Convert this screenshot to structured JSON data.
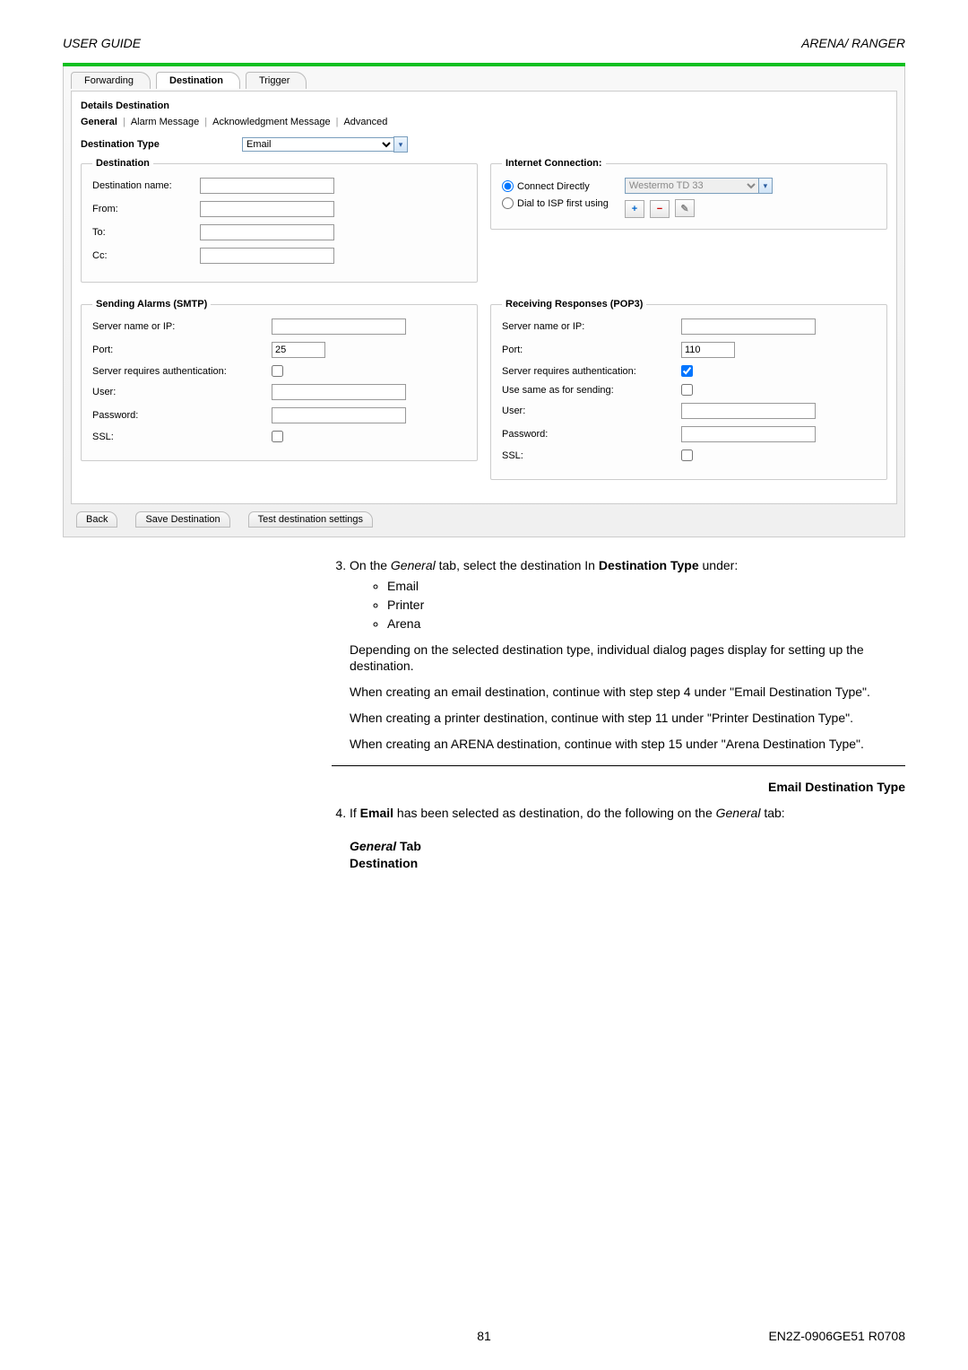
{
  "header": {
    "left": "USER GUIDE",
    "right": "ARENA/ RANGER"
  },
  "shot": {
    "top_tabs": {
      "forwarding": "Forwarding",
      "destination": "Destination",
      "trigger": "Trigger"
    },
    "section_title": "Details Destination",
    "sub_tabs": {
      "general": "General",
      "alarm": "Alarm Message",
      "ack": "Acknowledgment Message",
      "advanced": "Advanced"
    },
    "dest_type_label": "Destination Type",
    "dest_type_value": "Email",
    "destination_box": {
      "legend": "Destination",
      "fields": {
        "name_label": "Destination name:",
        "name_value": "",
        "from_label": "From:",
        "from_value": "",
        "to_label": "To:",
        "to_value": "",
        "cc_label": "Cc:",
        "cc_value": ""
      }
    },
    "internet_box": {
      "legend": "Internet Connection:",
      "connect_directly": "Connect Directly",
      "dial_isp": "Dial to ISP first using",
      "isp_value": "Westermo TD 33"
    },
    "smtp_box": {
      "legend": "Sending Alarms (SMTP)",
      "server_label": "Server name or IP:",
      "server_value": "",
      "port_label": "Port:",
      "port_value": "25",
      "auth_label": "Server requires authentication:",
      "user_label": "User:",
      "user_value": "",
      "pass_label": "Password:",
      "pass_value": "",
      "ssl_label": "SSL:"
    },
    "pop3_box": {
      "legend": "Receiving Responses (POP3)",
      "server_label": "Server name or IP:",
      "server_value": "",
      "port_label": "Port:",
      "port_value": "110",
      "auth_label": "Server requires authentication:",
      "same_label": "Use same as for sending:",
      "user_label": "User:",
      "user_value": "",
      "pass_label": "Password:",
      "pass_value": "",
      "ssl_label": "SSL:"
    },
    "bottom_buttons": {
      "back": "Back",
      "save": "Save Destination",
      "test": "Test destination settings"
    }
  },
  "doc": {
    "step3_intro_a": "On the ",
    "step3_intro_b": "General",
    "step3_intro_c": "  tab, select the destination In ",
    "step3_intro_d": "Destination Type",
    "step3_intro_e": " under:",
    "bullets": [
      "Email",
      "Printer",
      "Arena"
    ],
    "p1": "Depending on the selected destination type, individual dialog pages display for setting up the destination.",
    "p2": "When creating an email destination, continue with step step 4 under \"Email Destination Type\".",
    "p3": "When creating a printer destination, continue with step 11 under \"Printer Destination Type\".",
    "p4": "When creating an ARENA destination, continue with step 15 under \"Arena Destination Type\".",
    "email_dest_heading": "Email Destination Type",
    "step4_a": "If ",
    "step4_b": "Email",
    "step4_c": " has been selected as destination, do the following on the ",
    "step4_d": "General",
    "step4_e": " tab:",
    "general_tab_heading": "General",
    "general_tab_word": " Tab",
    "destination_heading": "Destination"
  },
  "footer": {
    "page": "81",
    "code": "EN2Z-0906GE51 R0708"
  }
}
